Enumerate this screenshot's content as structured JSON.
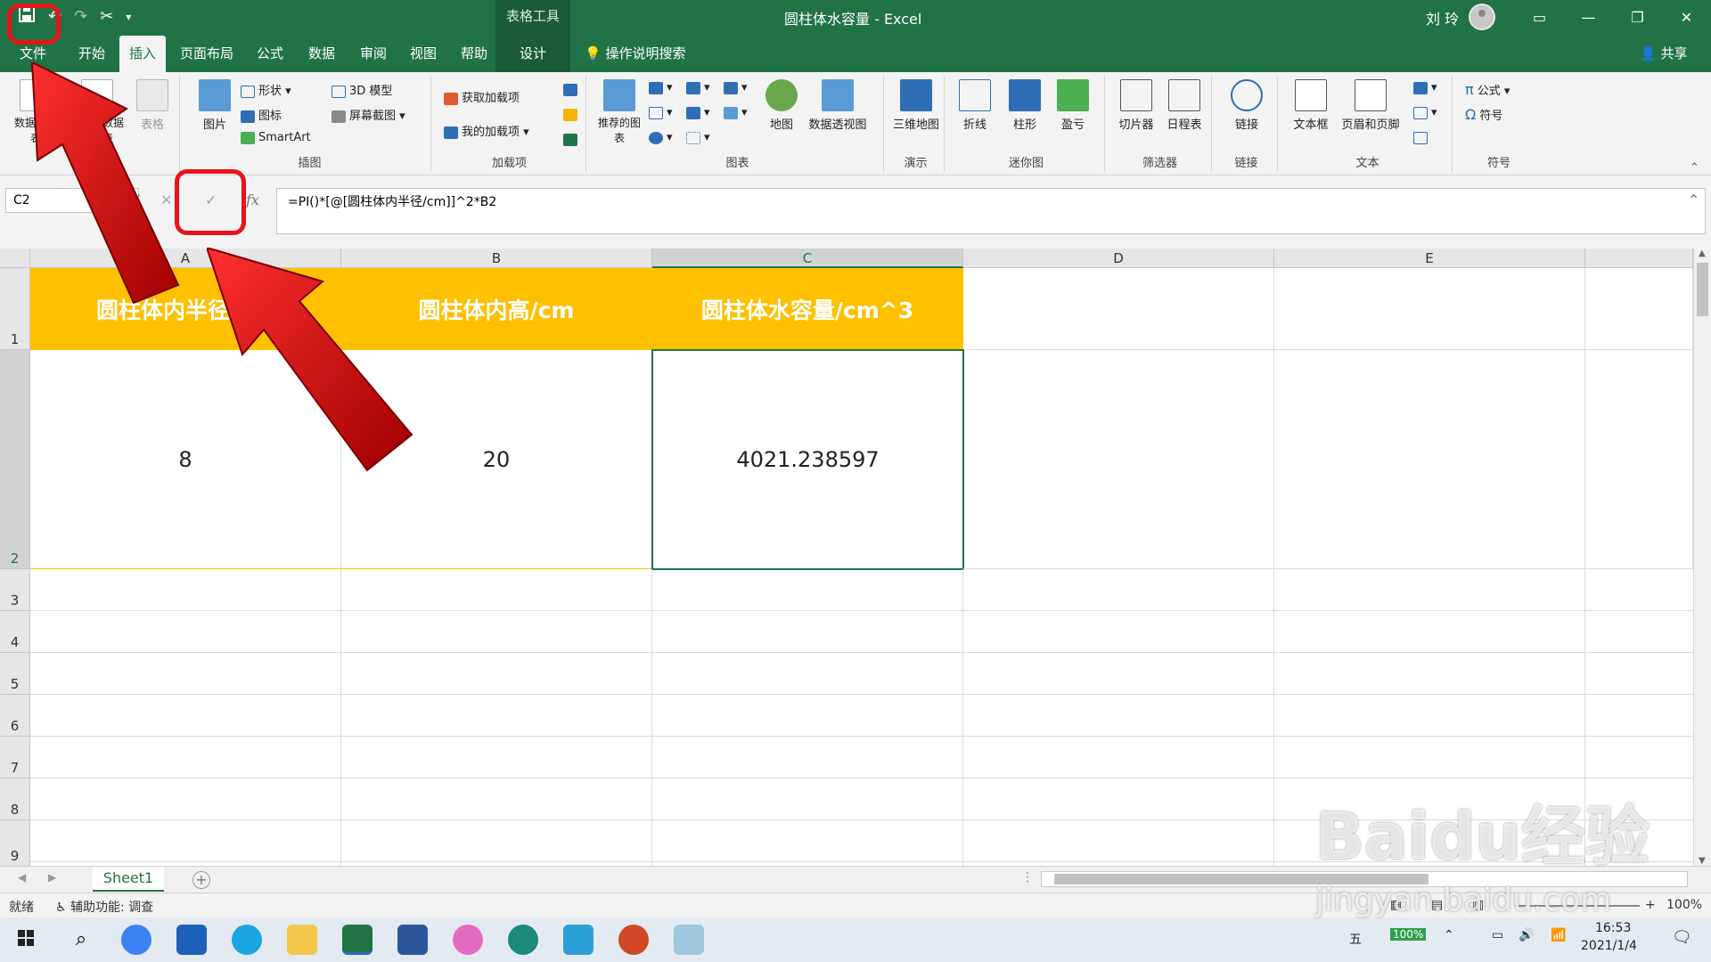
{
  "titlebar": {
    "context_tool": "表格工具",
    "window_title": "圆柱体水容量 - Excel",
    "user": "刘 玲"
  },
  "tabs": {
    "file": "文件",
    "home": "开始",
    "insert": "插入",
    "layout": "页面布局",
    "formulas": "公式",
    "data": "数据",
    "review": "审阅",
    "view": "视图",
    "help": "帮助",
    "design": "设计",
    "tell_me": "操作说明搜索",
    "share": "共享"
  },
  "ribbon": {
    "tables": {
      "pivot": "数据透视表",
      "recommended": "推荐的数据透视表",
      "table": "表格"
    },
    "illustrations": {
      "label": "插图",
      "pictures": "图片",
      "shapes": "形状",
      "icons": "图标",
      "smartart": "SmartArt",
      "model3d": "3D 模型",
      "screenshot": "屏幕截图"
    },
    "addins": {
      "label": "加载项",
      "get": "获取加载项",
      "my": "我的加载项"
    },
    "charts": {
      "label": "图表",
      "recommended": "推荐的图表",
      "maps": "地图",
      "pivotchart": "数据透视图"
    },
    "tours": {
      "label": "演示",
      "map3d": "三维地图"
    },
    "sparklines": {
      "label": "迷你图",
      "line": "折线",
      "column": "柱形",
      "winloss": "盈亏"
    },
    "filters": {
      "label": "筛选器",
      "slicer": "切片器",
      "timeline": "日程表"
    },
    "links": {
      "label": "链接",
      "link": "链接"
    },
    "text": {
      "label": "文本",
      "textbox": "文本框",
      "headerfooter": "页眉和页脚"
    },
    "symbols": {
      "label": "符号",
      "equation": "公式",
      "symbol": "符号"
    }
  },
  "formula_bar": {
    "name_box": "C2",
    "fx": "fx",
    "formula": "=PI()*[@[圆柱体内半径/cm]]^2*B2"
  },
  "grid": {
    "columns": [
      "A",
      "B",
      "C",
      "D",
      "E"
    ],
    "rows": [
      "1",
      "2",
      "3",
      "4",
      "5",
      "6",
      "7",
      "8",
      "9"
    ],
    "header_row": [
      "圆柱体内半径/cm",
      "圆柱体内高/cm",
      "圆柱体水容量/cm^3"
    ],
    "data_row": [
      "8",
      "20",
      "4021.238597"
    ]
  },
  "sheets": {
    "active": "Sheet1"
  },
  "status": {
    "ready": "就绪",
    "accessibility": "辅助功能: 调查",
    "zoom": "100%"
  },
  "taskbar": {
    "ime": "五",
    "battery": "100%",
    "time": "16:53",
    "date": "2021/1/4"
  },
  "watermark": {
    "brand": "Baidu经验",
    "site": "jingyan.baidu.com"
  },
  "colors": {
    "excel_green": "#217346",
    "header_fill": "#ffc000",
    "annotation_red": "#e8131b"
  }
}
